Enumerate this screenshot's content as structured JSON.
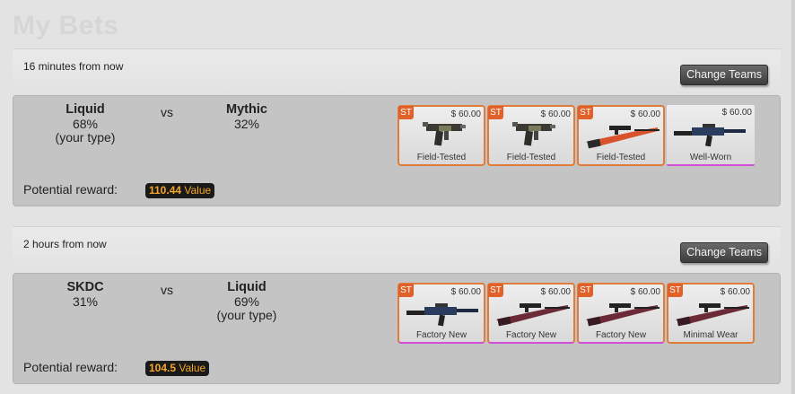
{
  "page": {
    "title": "My Bets"
  },
  "bets": [
    {
      "time": "16 minutes from now",
      "change_label": "Change Teams",
      "team_left": {
        "name": "Liquid",
        "pct": "68%",
        "note": "(your type)"
      },
      "vs": "vs",
      "team_right": {
        "name": "Mythic",
        "pct": "32%",
        "note": ""
      },
      "reward_label": "Potential reward:",
      "reward_value": "110.44",
      "reward_unit": "Value",
      "items": [
        {
          "tag": "ST",
          "price": "$ 60.00",
          "wear": "Field-Tested",
          "icon": "pistol-camo-icon",
          "border": "orange"
        },
        {
          "tag": "ST",
          "price": "$ 60.00",
          "wear": "Field-Tested",
          "icon": "pistol-camo-icon",
          "border": "orange"
        },
        {
          "tag": "ST",
          "price": "$ 60.00",
          "wear": "Field-Tested",
          "icon": "sniper-red-icon",
          "border": "orange"
        },
        {
          "tag": "",
          "price": "$ 60.00",
          "wear": "Well-Worn",
          "icon": "rifle-blue-icon",
          "border": "purple"
        }
      ]
    },
    {
      "time": "2 hours from now",
      "change_label": "Change Teams",
      "team_left": {
        "name": "SKDC",
        "pct": "31%",
        "note": ""
      },
      "vs": "vs",
      "team_right": {
        "name": "Liquid",
        "pct": "69%",
        "note": "(your type)"
      },
      "reward_label": "Potential reward:",
      "reward_value": "104.5",
      "reward_unit": "Value",
      "items": [
        {
          "tag": "ST",
          "price": "$ 60.00",
          "wear": "Factory New",
          "icon": "rifle-blue-icon",
          "border": "orange-purple"
        },
        {
          "tag": "ST",
          "price": "$ 60.00",
          "wear": "Factory New",
          "icon": "sniper-maroon-icon",
          "border": "orange-purple"
        },
        {
          "tag": "ST",
          "price": "$ 60.00",
          "wear": "Factory New",
          "icon": "sniper-maroon-icon",
          "border": "orange-purple"
        },
        {
          "tag": "ST",
          "price": "$ 60.00",
          "wear": "Minimal Wear",
          "icon": "sniper-maroon-icon",
          "border": "orange"
        }
      ]
    }
  ]
}
